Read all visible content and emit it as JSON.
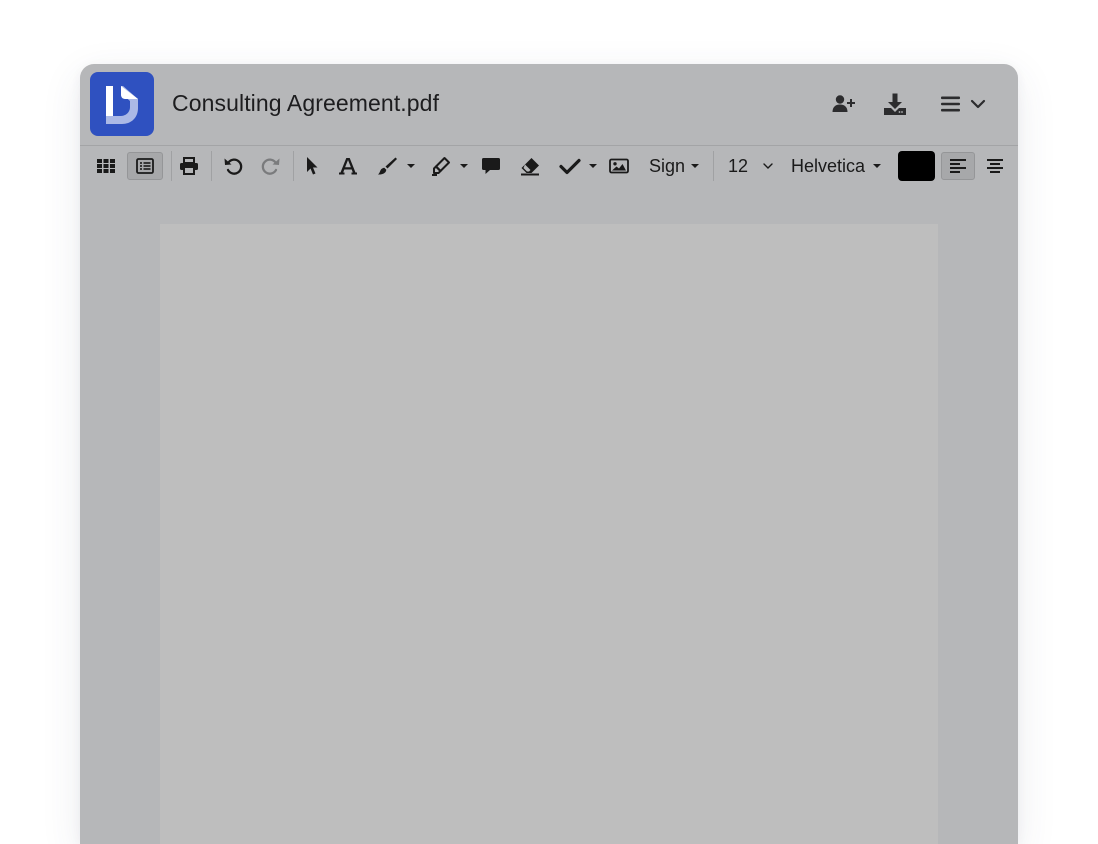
{
  "app": {
    "document_title": "Consulting Agreement.pdf",
    "logo_icon": "doc-d-logo"
  },
  "header": {
    "share_icon": "add-user-icon",
    "download_icon": "download-icon",
    "menu_icon": "hamburger-menu-icon"
  },
  "toolbar": {
    "sign_label": "Sign",
    "font_size": "12",
    "font_family": "Helvetica",
    "text_color": "#000000"
  },
  "colors": {
    "brand": "#2f51c0",
    "chrome": "#b6b7b9",
    "page": "#bebebe"
  }
}
